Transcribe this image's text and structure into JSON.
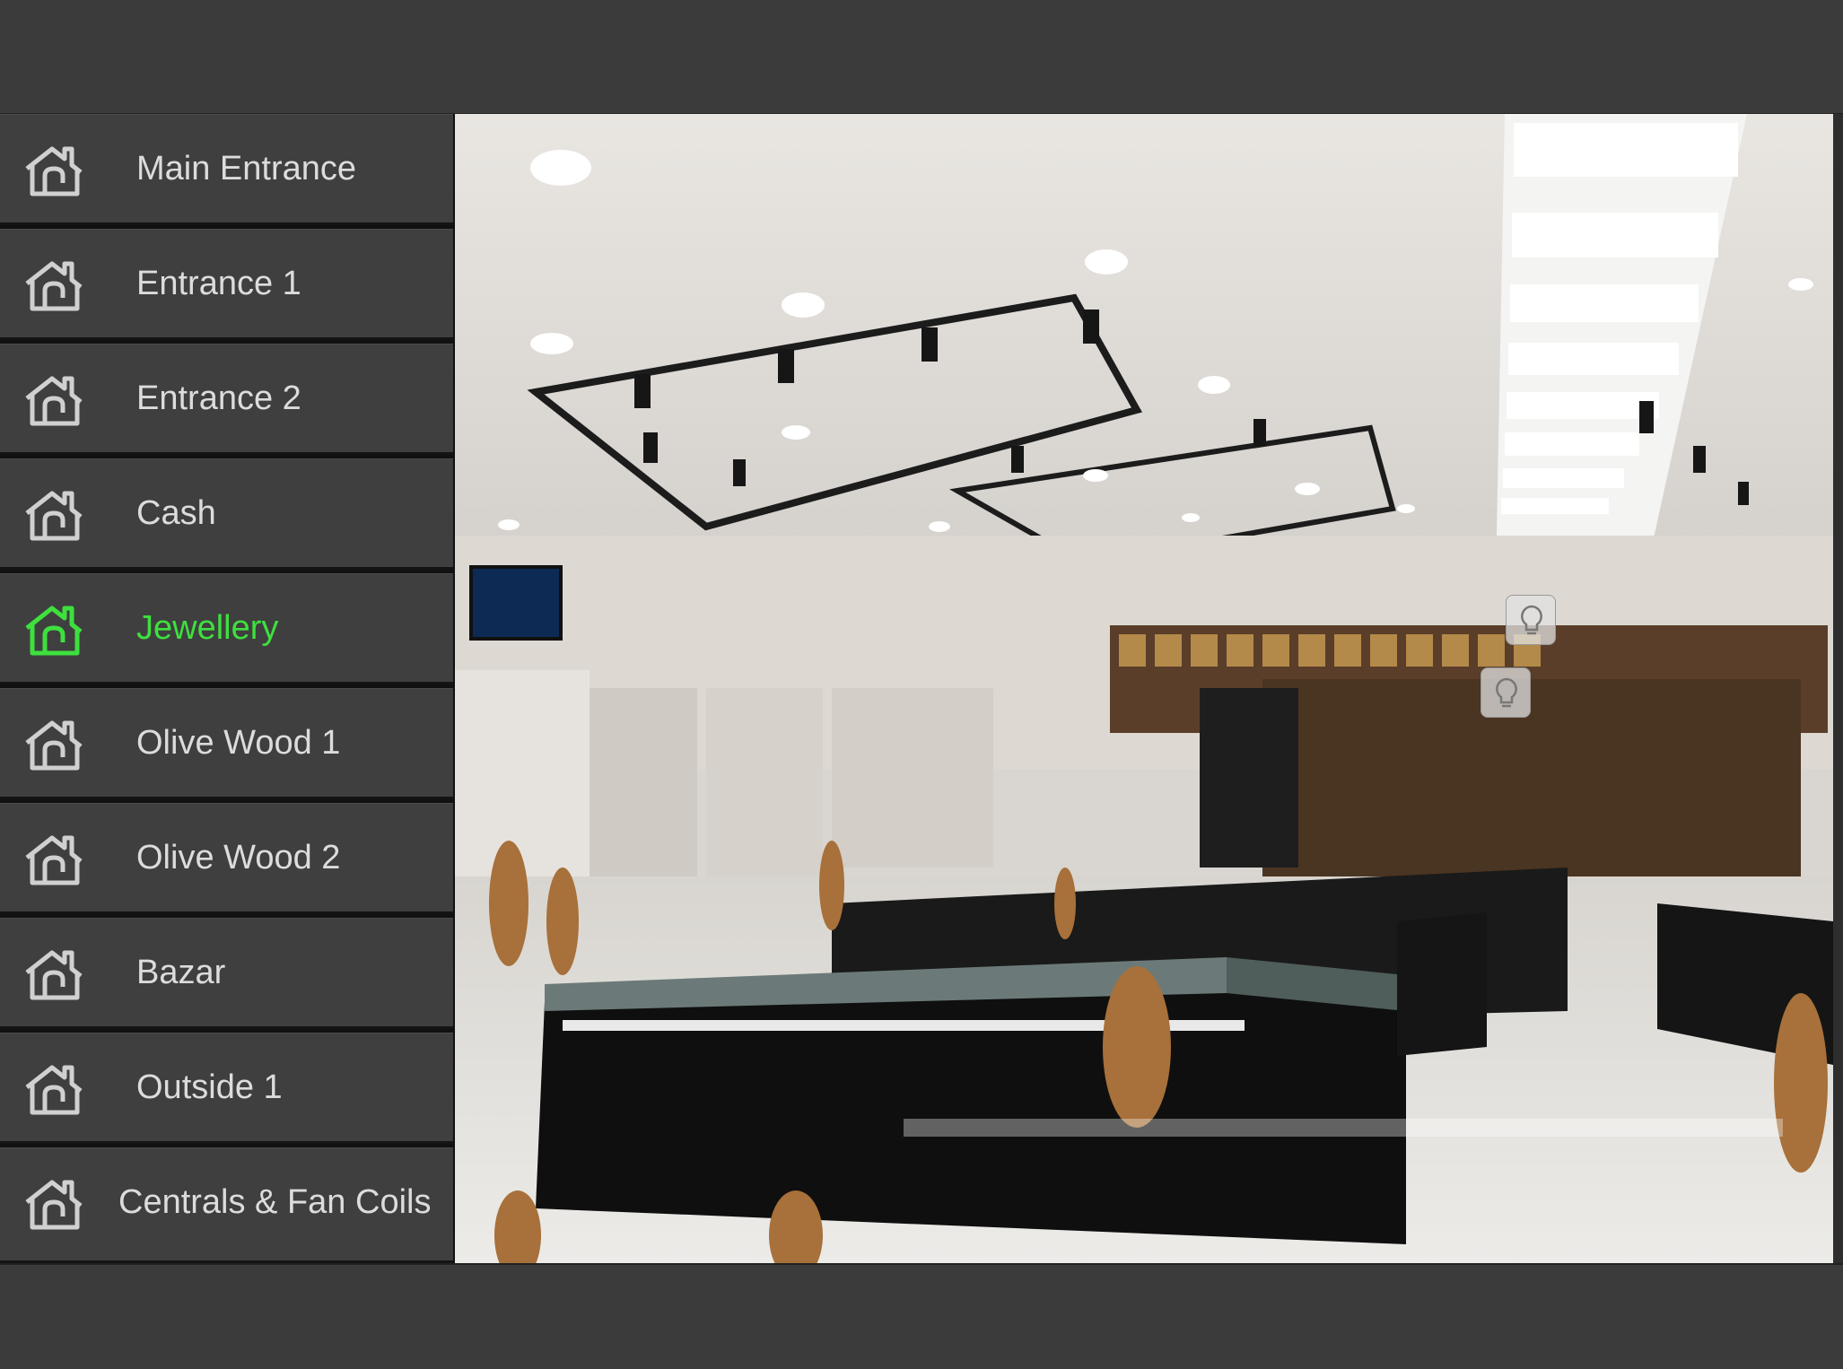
{
  "rooms": [
    {
      "label": "Main Entrance",
      "active": false
    },
    {
      "label": "Entrance 1",
      "active": false
    },
    {
      "label": "Entrance 2",
      "active": false
    },
    {
      "label": "Cash",
      "active": false
    },
    {
      "label": "Jewellery",
      "active": true
    },
    {
      "label": "Olive Wood 1",
      "active": false
    },
    {
      "label": "Olive Wood 2",
      "active": false
    },
    {
      "label": "Bazar",
      "active": false
    },
    {
      "label": "Outside 1",
      "active": false
    },
    {
      "label": "Centrals & Fan Coils",
      "active": false
    }
  ],
  "icons": {
    "room": "house-icon",
    "light": "light-bulb-icon"
  },
  "colors": {
    "active": "#3ee03e",
    "inactive": "#dcdcdc",
    "panel": "#3f3f3f",
    "background": "#3b3b3b"
  }
}
